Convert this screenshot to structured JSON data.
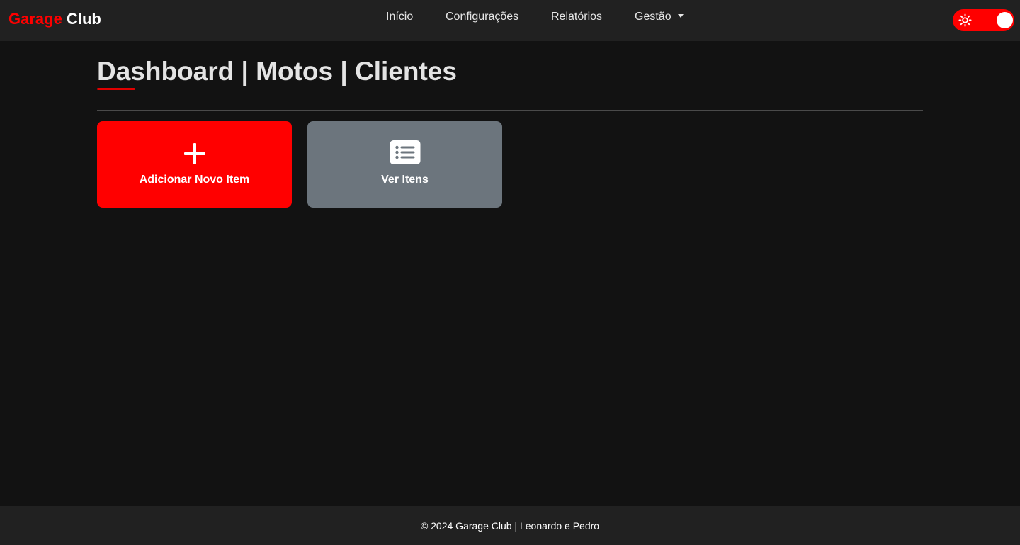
{
  "brand": {
    "part1": "Garage",
    "part2": "Club"
  },
  "nav": {
    "inicio": "Início",
    "configuracoes": "Configurações",
    "relatorios": "Relatórios",
    "gestao": "Gestão"
  },
  "theme_toggle": {
    "icon": "sun-icon",
    "state": "on",
    "accent": "#ff0000"
  },
  "page": {
    "title": "Dashboard | Motos | Clientes"
  },
  "cards": {
    "add": {
      "label": "Adicionar Novo Item",
      "icon": "plus-icon",
      "color": "#ff0000"
    },
    "view": {
      "label": "Ver Itens",
      "icon": "list-icon",
      "color": "#6c757d"
    }
  },
  "footer": {
    "text": "© 2024 Garage Club | Leonardo e Pedro"
  },
  "colors": {
    "background": "#121212",
    "navbar": "#212121",
    "accent": "#ff0000"
  }
}
